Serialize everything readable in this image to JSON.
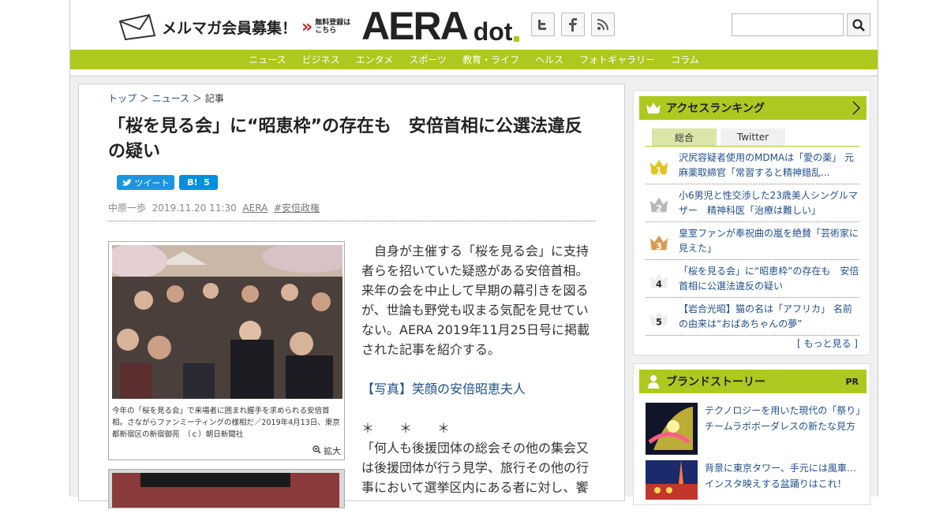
{
  "header": {
    "mailmag_label": "メルマガ会員募集！",
    "mailmag_sub1": "無料登録は",
    "mailmag_sub2": "こちら",
    "logo_main": "AERA",
    "logo_sub": "dot",
    "social": [
      "twitter-icon",
      "facebook-icon",
      "rss-icon"
    ],
    "search_placeholder": ""
  },
  "nav": [
    "ニュース",
    "ビジネス",
    "エンタメ",
    "スポーツ",
    "教育・ライフ",
    "ヘルス",
    "フォトギャラリー",
    "コラム"
  ],
  "breadcrumb": {
    "home": "トップ",
    "news": "ニュース",
    "current": "記事"
  },
  "article": {
    "title": "「桜を見る会」に“昭恵枠”の存在も　安倍首相に公選法違反の疑い",
    "tweet_label": "ツイート",
    "hatena_label": "B!",
    "hatena_count": "5",
    "author": "中原一歩",
    "date": "2019.11.20 11:30",
    "source": "AERA",
    "tag": "#安倍政権",
    "photo_caption": "今年の「桜を見る会」で来場者に囲まれ握手を求められる安倍首相。さながらファンミーティングの様相だ／2019年4月13日、東京都新宿区の新宿御苑　（ｃ）朝日新聞社",
    "zoom_label": "拡大",
    "para1": "　自身が主催する「桜を見る会」に支持者らを招いていた疑惑がある安倍首相。来年の会を中止して早期の幕引きを図るが、世論も野党も収まる気配を見せていない。AERA 2019年11月25日号に掲載された記事を紹介する。",
    "photo_link": "【写真】笑顔の安倍昭恵夫人",
    "stars": "＊　　＊　　＊",
    "para2": "「何人も後援団体の総会その他の集会又は後援団体が行う見学、旅行その他の行事において選挙区内にある者に対し、饗"
  },
  "ranking": {
    "title": "アクセスランキング",
    "tabs": [
      "総合",
      "Twitter"
    ],
    "items": [
      {
        "rank": "1",
        "text": "沢尻容疑者使用のMDMAは「愛の薬」 元麻薬取締官「常習すると精神錯乱..."
      },
      {
        "rank": "2",
        "text": "小6男児と性交渉した23歳美人シングルマザー　精神科医「治療は難しい」"
      },
      {
        "rank": "3",
        "text": "皇室ファンが奉祝曲の嵐を絶賛「芸術家に見えた」"
      },
      {
        "rank": "4",
        "text": "「桜を見る会」に“昭恵枠”の存在も　安倍首相に公選法違反の疑い"
      },
      {
        "rank": "5",
        "text": "【岩合光昭】猫の名は「アフリカ」 名前の由来は“おばあちゃんの夢”"
      }
    ],
    "more": "[ もっと見る ]"
  },
  "brand": {
    "title": "ブランドストーリー",
    "pr": "PR",
    "items": [
      {
        "text": "テクノロジーを用いた現代の「祭り」チームラボボーダレスの新たな見方"
      },
      {
        "text": "背景に東京タワー、手元には風車…インスタ映えする盆踊りはこれ！"
      }
    ]
  },
  "colors": {
    "accent": "#aec81f",
    "link": "#1f4f8c",
    "twitter": "#1b95e0",
    "hatena": "#008fde"
  }
}
